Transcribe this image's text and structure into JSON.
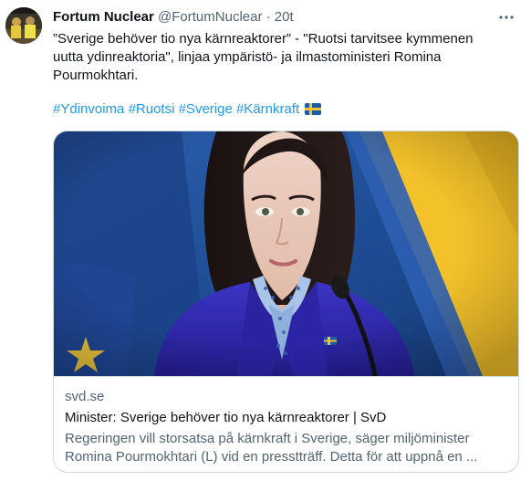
{
  "tweet": {
    "author_name": "Fortum Nuclear",
    "author_handle": "@FortumNuclear",
    "separator": "·",
    "time": "20t",
    "more_icon": "more-icon",
    "text_lines": [
      "”Sverige behöver tio nya kärnreaktorer” - \"Ruotsi tarvitsee kymmenen",
      "uutta ydinreaktoria\", linjaa ympäristö- ja ilmastoministeri Romina",
      "Pourmokhtari."
    ],
    "hashtags": [
      "#Ydinvoima",
      "#Ruotsi",
      "#Sverige",
      "#Kärnkraft"
    ],
    "flag_emoji": "swedish-flag-icon"
  },
  "card": {
    "domain": "svd.se",
    "title": "Minister: Sverige behöver tio nya kärnreaktorer | SvD",
    "description_lines": [
      "Regeringen vill storsatsa på kärnkraft i Sverige, säger miljöminister",
      "Romina Pourmokhtari (L) vid en presstträff. Detta för att uppnå en ..."
    ]
  },
  "colors": {
    "link": "#1d9bf0",
    "secondary_text": "#536471",
    "border": "#cfd9de",
    "flag_blue": "#1f5aa8",
    "flag_yellow": "#f4c22b"
  }
}
